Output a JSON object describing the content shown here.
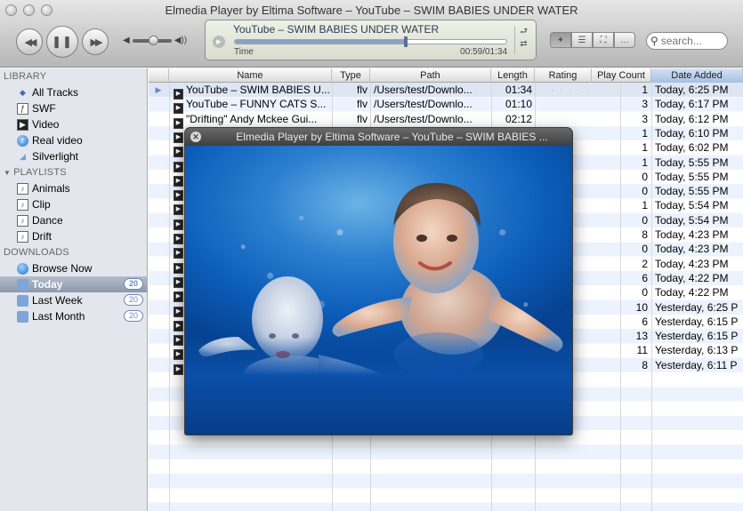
{
  "window": {
    "title": "Elmedia Player by Eltima Software – YouTube – SWIM BABIES UNDER WATER"
  },
  "controls": {
    "rewind_icon": "rewind-icon",
    "pause_icon": "pause-icon",
    "forward_icon": "fast-forward-icon"
  },
  "now_playing": {
    "title": "YouTube – SWIM BABIES UNDER WATER",
    "time_label": "Time",
    "time": "00:59/01:34",
    "progress": 0.63
  },
  "search": {
    "placeholder": "search..."
  },
  "sidebar": {
    "library_label": "LIBRARY",
    "library": [
      {
        "label": "All Tracks",
        "icon": "all-tracks-icon"
      },
      {
        "label": "SWF",
        "icon": "swf-icon"
      },
      {
        "label": "Video",
        "icon": "video-icon"
      },
      {
        "label": "Real video",
        "icon": "real-video-icon"
      },
      {
        "label": "Silverlight",
        "icon": "silverlight-icon"
      }
    ],
    "playlists_label": "PLAYLISTS",
    "playlists": [
      {
        "label": "Animals"
      },
      {
        "label": "Clip"
      },
      {
        "label": "Dance"
      },
      {
        "label": "Drift"
      }
    ],
    "downloads_label": "DOWNLOADS",
    "downloads": [
      {
        "label": "Browse Now",
        "icon": "globe-icon"
      },
      {
        "label": "Today",
        "count": "20",
        "selected": true
      },
      {
        "label": "Last Week",
        "count": "20"
      },
      {
        "label": "Last Month",
        "count": "20"
      }
    ]
  },
  "table": {
    "columns": [
      "Name",
      "Type",
      "Path",
      "Length",
      "Rating",
      "Play Count",
      "Date Added"
    ],
    "rows": [
      {
        "name": "YouTube – SWIM BABIES U...",
        "type": "flv",
        "path": "/Users/test/Downlo...",
        "length": "01:34",
        "rating": "· · · · ·",
        "plays": "1",
        "date": "Today, 6:25 PM",
        "playing": true
      },
      {
        "name": "YouTube – FUNNY CATS S...",
        "type": "flv",
        "path": "/Users/test/Downlo...",
        "length": "01:10",
        "rating": "",
        "plays": "3",
        "date": "Today, 6:17 PM"
      },
      {
        "name": "\"Drifting\" Andy Mckee Gui...",
        "type": "flv",
        "path": "/Users/test/Downlo...",
        "length": "02:12",
        "rating": "",
        "plays": "3",
        "date": "Today, 6:12 PM"
      },
      {
        "name": "",
        "type": "",
        "path": "",
        "length": "",
        "rating": "",
        "plays": "1",
        "date": "Today, 6:10 PM"
      },
      {
        "name": "",
        "type": "",
        "path": "",
        "length": "",
        "rating": "",
        "plays": "1",
        "date": "Today, 6:02 PM"
      },
      {
        "name": "",
        "type": "",
        "path": "",
        "length": "",
        "rating": "",
        "plays": "1",
        "date": "Today, 5:55 PM"
      },
      {
        "name": "",
        "type": "",
        "path": "",
        "length": "",
        "rating": "",
        "plays": "0",
        "date": "Today, 5:55 PM"
      },
      {
        "name": "",
        "type": "",
        "path": "",
        "length": "",
        "rating": "",
        "plays": "0",
        "date": "Today, 5:55 PM"
      },
      {
        "name": "",
        "type": "",
        "path": "",
        "length": "",
        "rating": "",
        "plays": "1",
        "date": "Today, 5:54 PM"
      },
      {
        "name": "",
        "type": "",
        "path": "",
        "length": "",
        "rating": "",
        "plays": "0",
        "date": "Today, 5:54 PM"
      },
      {
        "name": "",
        "type": "",
        "path": "",
        "length": "",
        "rating": "",
        "plays": "8",
        "date": "Today, 4:23 PM"
      },
      {
        "name": "",
        "type": "",
        "path": "",
        "length": "",
        "rating": "",
        "plays": "0",
        "date": "Today, 4:23 PM"
      },
      {
        "name": "",
        "type": "",
        "path": "",
        "length": "",
        "rating": "",
        "plays": "2",
        "date": "Today, 4:23 PM"
      },
      {
        "name": "",
        "type": "",
        "path": "",
        "length": "",
        "rating": "",
        "plays": "6",
        "date": "Today, 4:22 PM"
      },
      {
        "name": "",
        "type": "",
        "path": "",
        "length": "",
        "rating": "",
        "plays": "0",
        "date": "Today, 4:22 PM"
      },
      {
        "name": "",
        "type": "",
        "path": "",
        "length": "",
        "rating": "",
        "plays": "10",
        "date": "Yesterday, 6:25 P"
      },
      {
        "name": "",
        "type": "",
        "path": "",
        "length": "",
        "rating": "",
        "plays": "6",
        "date": "Yesterday, 6:15 P"
      },
      {
        "name": "",
        "type": "",
        "path": "",
        "length": "",
        "rating": "",
        "plays": "13",
        "date": "Yesterday, 6:15 P"
      },
      {
        "name": "",
        "type": "",
        "path": "",
        "length": "",
        "rating": "",
        "plays": "11",
        "date": "Yesterday, 6:13 P"
      },
      {
        "name": "",
        "type": "",
        "path": "",
        "length": "",
        "rating": "",
        "plays": "8",
        "date": "Yesterday, 6:11 P"
      }
    ]
  },
  "player_window": {
    "title": "Elmedia Player by Eltima Software – YouTube – SWIM BABIES ..."
  },
  "colors": {
    "accent": "#6b86c8",
    "selection": "#8c98ab",
    "water": "#0b5cb8"
  }
}
